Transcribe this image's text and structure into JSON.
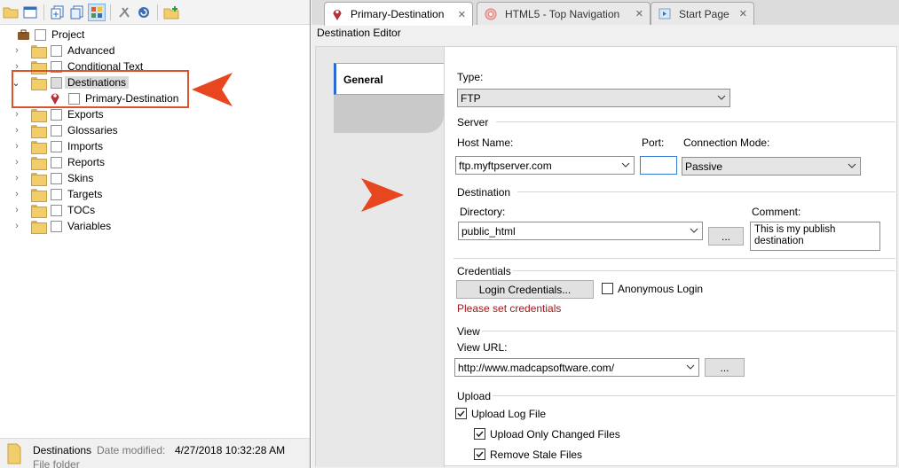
{
  "toolbar": {
    "icons": [
      "open-folder-icon",
      "window-icon",
      "add-file-icon",
      "copy-file-icon",
      "grid-view-icon",
      "scissors-icon",
      "refresh-icon",
      "new-folder-icon"
    ]
  },
  "tree": {
    "root": "Project",
    "items": [
      {
        "label": "Advanced",
        "expanded": false
      },
      {
        "label": "Conditional Text",
        "expanded": false
      },
      {
        "label": "Destinations",
        "expanded": true,
        "selected": true
      },
      {
        "label": "Primary-Destination",
        "child": true
      },
      {
        "label": "Exports",
        "expanded": false
      },
      {
        "label": "Glossaries",
        "expanded": false
      },
      {
        "label": "Imports",
        "expanded": false
      },
      {
        "label": "Reports",
        "expanded": false
      },
      {
        "label": "Skins",
        "expanded": false
      },
      {
        "label": "Targets",
        "expanded": false
      },
      {
        "label": "TOCs",
        "expanded": false
      },
      {
        "label": "Variables",
        "expanded": false
      }
    ]
  },
  "status": {
    "name": "Destinations",
    "modified_label": "Date modified:",
    "modified_value": "4/27/2018 10:32:28 AM",
    "type": "File folder"
  },
  "tabs": [
    {
      "label": "Primary-Destination",
      "active": true
    },
    {
      "label": "HTML5 - Top Navigation",
      "active": false
    },
    {
      "label": "Start Page",
      "active": false
    }
  ],
  "editor": {
    "title": "Destination Editor",
    "side_tab": "General",
    "type_label": "Type:",
    "type_value": "FTP",
    "server_section": "Server",
    "host_label": "Host Name:",
    "host_value": "ftp.myftpserver.com",
    "port_label": "Port:",
    "port_value": "",
    "mode_label": "Connection Mode:",
    "mode_value": "Passive",
    "destination_section": "Destination",
    "directory_label": "Directory:",
    "directory_value": "public_html",
    "browse_label": "...",
    "comment_label": "Comment:",
    "comment_value": "This is my publish destination",
    "credentials_section": "Credentials",
    "login_button": "Login Credentials...",
    "anon_label": "Anonymous Login",
    "anon_checked": false,
    "credentials_warning": "Please set credentials",
    "view_section": "View",
    "view_url_label": "View URL:",
    "view_url_value": "http://www.madcapsoftware.com/",
    "view_browse_label": "...",
    "upload_section": "Upload",
    "upload_log_label": "Upload Log File",
    "upload_log_checked": true,
    "upload_changed_label": "Upload Only Changed Files",
    "upload_changed_checked": true,
    "remove_stale_label": "Remove Stale Files",
    "remove_stale_checked": true
  },
  "colors": {
    "highlight": "#d9542a",
    "pointer": "#e8461e",
    "warning": "#a01818",
    "tab_accent": "#2c6bd6"
  }
}
